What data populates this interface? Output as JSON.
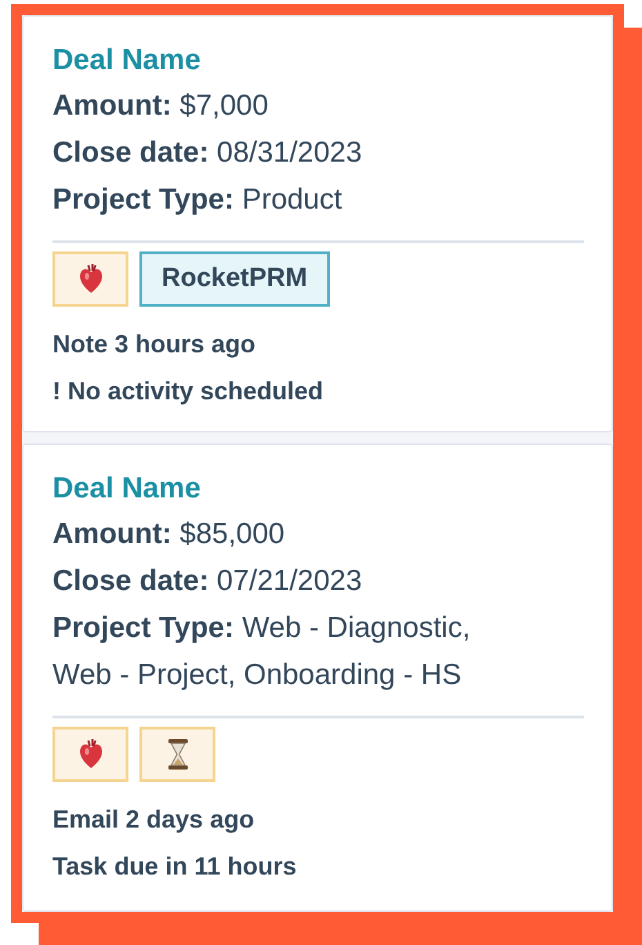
{
  "deals": [
    {
      "title": "Deal Name",
      "fields": [
        {
          "label": "Amount:",
          "value": "$7,000"
        },
        {
          "label": "Close date:",
          "value": "08/31/2023"
        },
        {
          "label": "Project Type:",
          "value": "Product"
        }
      ],
      "tags": [
        {
          "kind": "heart"
        },
        {
          "kind": "label",
          "text": "RocketPRM"
        }
      ],
      "activity": [
        "Note 3 hours ago",
        "! No activity scheduled"
      ]
    },
    {
      "title": "Deal Name",
      "fields": [
        {
          "label": "Amount:",
          "value": "$85,000"
        },
        {
          "label": "Close date:",
          "value": "07/21/2023"
        },
        {
          "label": "Project Type:",
          "value": "Web - Diagnostic, Web - Project, Onboarding - HS"
        }
      ],
      "tags": [
        {
          "kind": "heart"
        },
        {
          "kind": "hourglass"
        }
      ],
      "activity": [
        "Email 2 days ago",
        "Task due in 11 hours"
      ]
    }
  ]
}
